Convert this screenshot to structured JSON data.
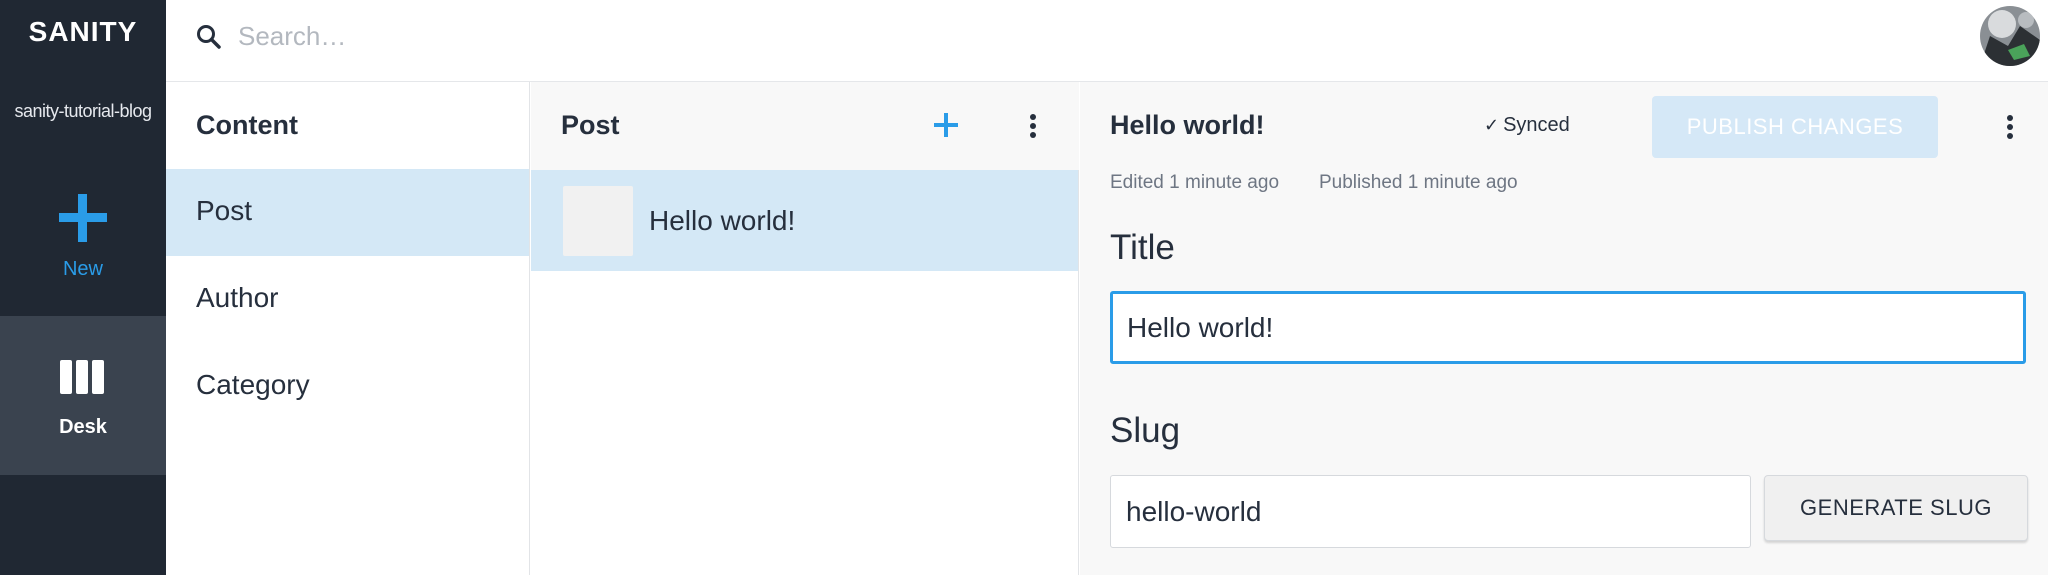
{
  "nav": {
    "logo": "SANITY",
    "project_name": "sanity-tutorial-blog",
    "new_label": "New",
    "desk_label": "Desk"
  },
  "search": {
    "placeholder": "Search…",
    "value": ""
  },
  "content_pane": {
    "title": "Content",
    "items": [
      {
        "label": "Post",
        "active": true
      },
      {
        "label": "Author",
        "active": false
      },
      {
        "label": "Category",
        "active": false
      }
    ]
  },
  "list_pane": {
    "title": "Post",
    "documents": [
      {
        "title": "Hello world!",
        "selected": true
      }
    ]
  },
  "editor": {
    "heading": "Hello world!",
    "sync_status": "Synced",
    "publish_label": "PUBLISH CHANGES",
    "edited": "Edited 1 minute ago",
    "published": "Published 1 minute ago",
    "fields": {
      "title_label": "Title",
      "title_value": "Hello world!",
      "slug_label": "Slug",
      "slug_value": "hello-world",
      "generate_slug_label": "GENERATE SLUG"
    }
  },
  "colors": {
    "nav_bg": "#202833",
    "accent": "#2a9ce8",
    "selected_bg": "#d4e8f6",
    "publish_disabled": "#d5e8f7"
  },
  "icons": {
    "search": "search-icon",
    "new": "plus-icon",
    "desk": "columns-icon",
    "add": "plus-icon",
    "menu": "more-vertical-icon",
    "synced": "check-icon"
  }
}
